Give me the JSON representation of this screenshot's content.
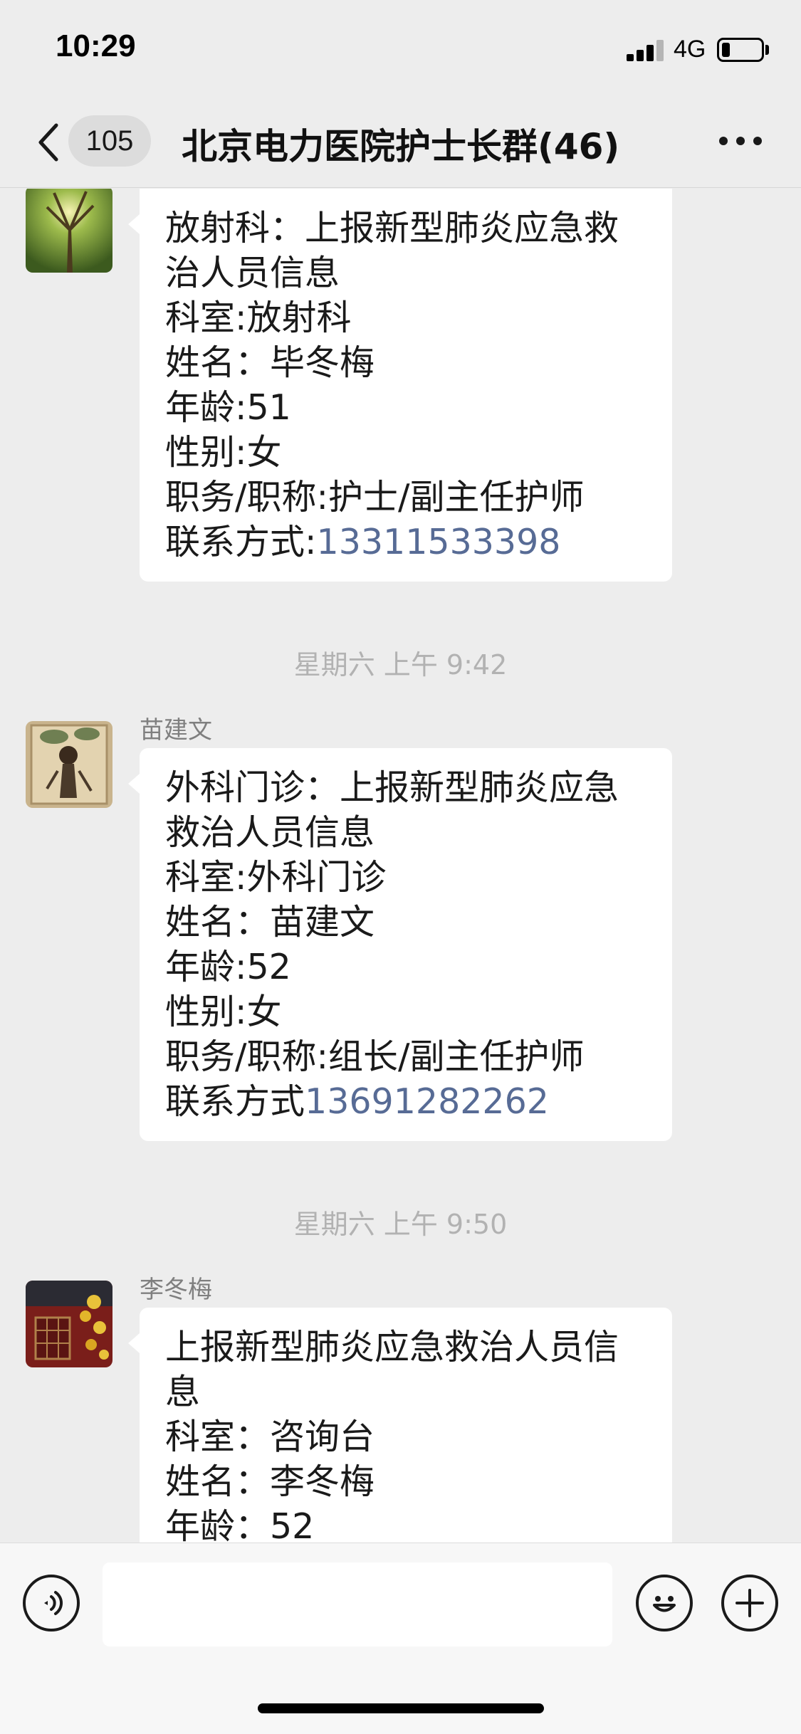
{
  "status_bar": {
    "time": "10:29",
    "network": "4G",
    "battery_level": 0.2
  },
  "nav": {
    "unread_count": "105",
    "title": "北京电力医院护士长群(46)"
  },
  "messages": [
    {
      "sender": "",
      "lines": [
        "放射科：上报新型肺炎应急救",
        "治人员信息",
        "科室:放射科",
        "姓名：毕冬梅",
        "年龄:51",
        "性别:女",
        "职务/职称:护士/副主任护师"
      ],
      "contact_label": "联系方式:",
      "contact_phone": "13311533398"
    },
    {
      "timestamp": "星期六 上午 9:42",
      "sender": "苗建文",
      "lines": [
        "外科门诊：上报新型肺炎应急",
        "救治人员信息",
        "科室:外科门诊",
        "姓名：苗建文",
        "年龄:52",
        "性别:女",
        "职务/职称:组长/副主任护师"
      ],
      "contact_label": "联系方式",
      "contact_phone": "13691282262"
    },
    {
      "timestamp": "星期六 上午 9:50",
      "sender": "李冬梅",
      "lines": [
        "上报新型肺炎应急救治人员信",
        "息",
        "科室：咨询台",
        "姓名：李冬梅",
        "年龄：52"
      ]
    }
  ],
  "icons": {
    "back": "chevron-left-icon",
    "more": "more-dots-icon",
    "voice": "voice-icon",
    "emoji": "emoji-icon",
    "plus": "plus-icon"
  }
}
